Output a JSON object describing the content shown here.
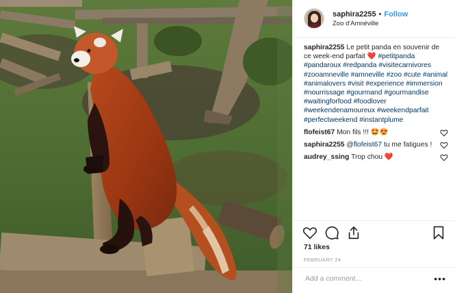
{
  "photo": {
    "alt": "Red panda standing on a wooden beam"
  },
  "header": {
    "username": "saphira2255",
    "separator": "•",
    "follow_label": "Follow",
    "location": "Zoo d'Amnéville"
  },
  "caption": {
    "user": "saphira2255",
    "text": "Le petit panda en souvenir de ce week-end parfait",
    "emoji": "❤️",
    "hashtags": "#petitpanda #pandaroux #redpanda #visitecarnivores #zooamneville #amneville #zoo #cute #animal #animalovers #visit #experience #immersion #nourrissage #gourmand #gourmandise #waitingforfood #foodlover #weekendenamoureux #weekendparfait #perfectweekend #instantplume"
  },
  "comments": [
    {
      "user": "flofeist67",
      "text": "Mon fils !!! 🤩😍"
    },
    {
      "user": "saphira2255",
      "mention": "@flofeist67",
      "text": " tu me fatigues !"
    },
    {
      "user": "audrey_ssing",
      "text": "Trop chou ❤️"
    }
  ],
  "actions": {
    "like_icon": "heart-icon",
    "comment_icon": "comment-icon",
    "share_icon": "share-icon",
    "save_icon": "bookmark-icon"
  },
  "likes_text": "71 likes",
  "date_text": "FEBRUARY 24",
  "add_comment": {
    "placeholder": "Add a comment...",
    "more_label": "•••"
  },
  "colors": {
    "link": "#3897f0",
    "hashtag": "#003569",
    "heart": "#ed4956",
    "muted": "#999999"
  }
}
